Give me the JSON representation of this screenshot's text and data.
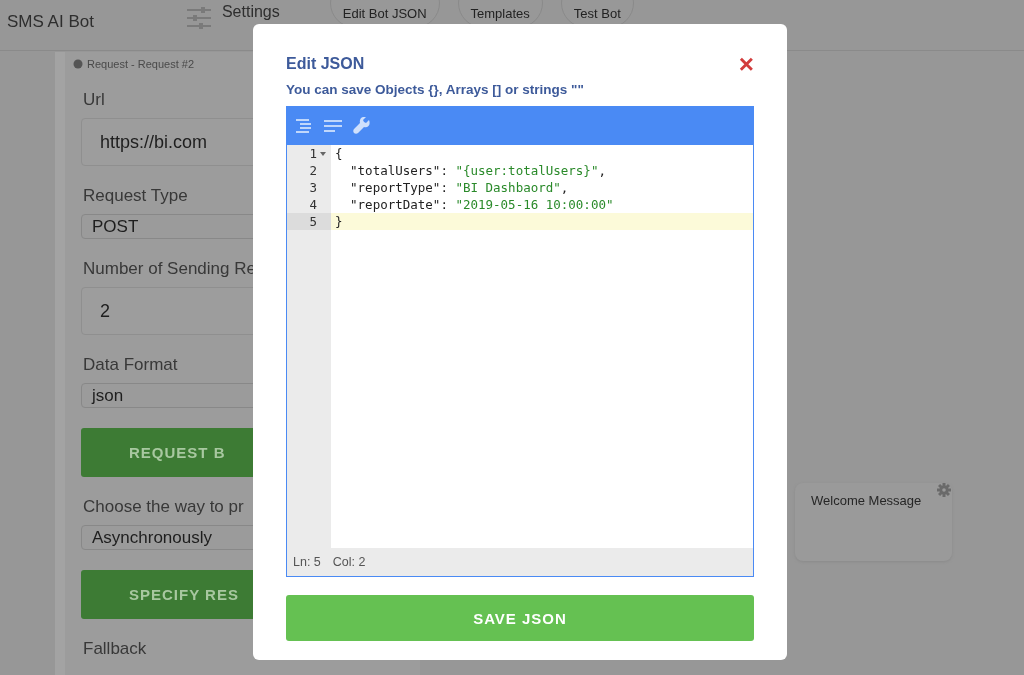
{
  "header": {
    "title": "SMS AI Bot",
    "settings_label": "Settings",
    "tabs": [
      {
        "label": "Edit Bot JSON"
      },
      {
        "label": "Templates"
      },
      {
        "label": "Test Bot"
      }
    ]
  },
  "request_panel": {
    "title": "Request - Request #2",
    "fields": [
      {
        "kind": "input",
        "label": "Url",
        "value": "https://bi.com"
      },
      {
        "kind": "select",
        "label": "Request Type",
        "value": "POST"
      },
      {
        "kind": "input",
        "label": "Number of Sending Re",
        "value": "2"
      },
      {
        "kind": "select",
        "label": "Data Format",
        "value": "json"
      },
      {
        "kind": "button",
        "label": "REQUEST B"
      },
      {
        "kind": "select",
        "label": "Choose the way to pr",
        "value": "Asynchronously"
      },
      {
        "kind": "button",
        "label": "SPECIFY RES"
      },
      {
        "kind": "label",
        "label": "Fallback"
      }
    ]
  },
  "flow_node": {
    "title": "Welcome Message"
  },
  "modal": {
    "title": "Edit JSON",
    "subtitle": "You can save Objects {}, Arrays [] or strings \"\"",
    "close": "×",
    "editor": {
      "lines": [
        {
          "number": "1",
          "foldable": true,
          "active": false,
          "segments": [
            {
              "kind": "punct",
              "text": "{"
            }
          ]
        },
        {
          "number": "2",
          "foldable": false,
          "active": false,
          "segments": [
            {
              "kind": "key",
              "text": "\"totalUsers\""
            },
            {
              "kind": "punct",
              "text": ": "
            },
            {
              "kind": "string",
              "text": "\"{user:totalUsers}\""
            },
            {
              "kind": "punct",
              "text": ","
            }
          ]
        },
        {
          "number": "3",
          "foldable": false,
          "active": false,
          "segments": [
            {
              "kind": "key",
              "text": "\"reportType\""
            },
            {
              "kind": "punct",
              "text": ": "
            },
            {
              "kind": "string",
              "text": "\"BI Dashbaord\""
            },
            {
              "kind": "punct",
              "text": ","
            }
          ]
        },
        {
          "number": "4",
          "foldable": false,
          "active": false,
          "segments": [
            {
              "kind": "key",
              "text": "\"reportDate\""
            },
            {
              "kind": "punct",
              "text": ": "
            },
            {
              "kind": "string",
              "text": "\"2019-05-16 10:00:00\""
            }
          ]
        },
        {
          "number": "5",
          "foldable": false,
          "active": true,
          "segments": [
            {
              "kind": "punct",
              "text": "}"
            }
          ]
        }
      ],
      "status": [
        {
          "text": "Ln: 5"
        },
        {
          "text": "Col: 2"
        }
      ]
    },
    "save_button": "SAVE JSON"
  }
}
